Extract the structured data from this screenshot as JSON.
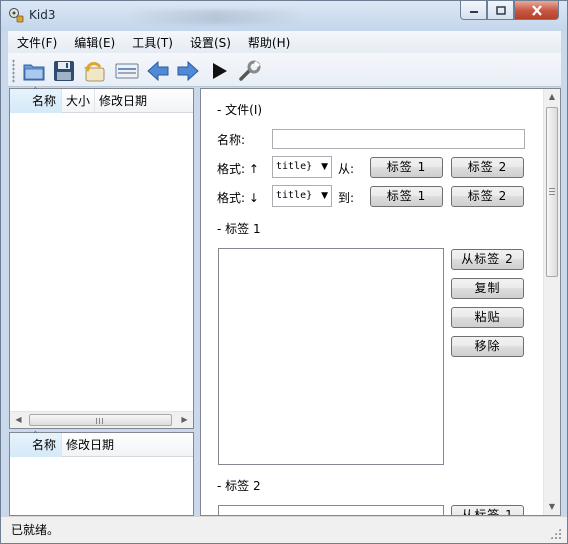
{
  "window": {
    "title": "Kid3"
  },
  "menu": [
    {
      "label": "文件(F)"
    },
    {
      "label": "编辑(E)"
    },
    {
      "label": "工具(T)"
    },
    {
      "label": "设置(S)"
    },
    {
      "label": "帮助(H)"
    }
  ],
  "toolbar": {
    "icons": [
      "open-folder-icon",
      "save-icon",
      "revert-icon",
      "playlist-icon",
      "previous-icon",
      "next-icon",
      "play-icon",
      "settings-wrench-icon"
    ]
  },
  "file_list": {
    "columns": [
      "名称",
      "大小",
      "修改日期"
    ]
  },
  "dir_list": {
    "columns": [
      "名称",
      "修改日期"
    ]
  },
  "file_section": {
    "title": "- 文件(I)",
    "name_label": "名称:",
    "name_value": "",
    "format_up_label": "格式: ↑",
    "format_up_value": "title}",
    "from_label": "从:",
    "format_down_label": "格式: ↓",
    "format_down_value": "title}",
    "to_label": "到:",
    "tag1_button": "标签 1",
    "tag2_button": "标签 2"
  },
  "tag1_section": {
    "title": "- 标签 1",
    "from_tag2_button": "从标签 2",
    "copy_button": "复制",
    "paste_button": "粘贴",
    "remove_button": "移除"
  },
  "tag2_section": {
    "title": "- 标签 2",
    "from_tag1_button_partial": "从标签 1"
  },
  "status": {
    "text": "已就绪。"
  },
  "colors": {
    "frame": "#c9d8ea",
    "close_button": "#c75641",
    "accent_blue": "#2f6fb5"
  }
}
